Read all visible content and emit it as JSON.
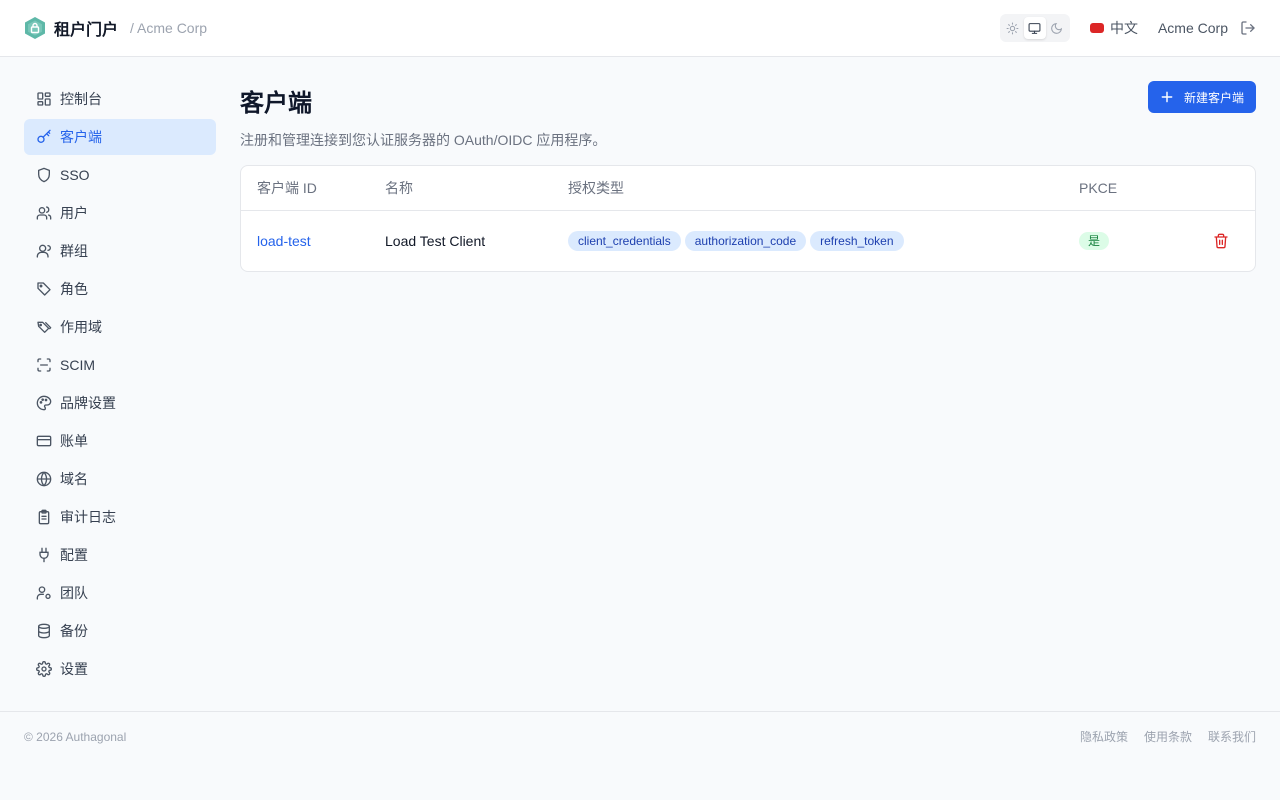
{
  "header": {
    "title": "租户门户",
    "tenant": "/ Acme Corp",
    "language": "中文",
    "account": "Acme Corp",
    "icons": [
      "shield-lock-logo",
      "sun-icon",
      "monitor-icon",
      "moon-icon",
      "flag-icon",
      "logout-icon"
    ]
  },
  "sidebar": {
    "items": [
      {
        "label": "控制台",
        "icon": "dashboard-icon"
      },
      {
        "label": "客户端",
        "icon": "key-icon",
        "active": true
      },
      {
        "label": "SSO",
        "icon": "shield-icon"
      },
      {
        "label": "用户",
        "icon": "users-icon"
      },
      {
        "label": "群组",
        "icon": "user-group-icon"
      },
      {
        "label": "角色",
        "icon": "tag-icon"
      },
      {
        "label": "作用域",
        "icon": "tags-icon"
      },
      {
        "label": "SCIM",
        "icon": "scan-icon"
      },
      {
        "label": "品牌设置",
        "icon": "palette-icon"
      },
      {
        "label": "账单",
        "icon": "credit-card-icon"
      },
      {
        "label": "域名",
        "icon": "globe-icon"
      },
      {
        "label": "审计日志",
        "icon": "clipboard-icon"
      },
      {
        "label": "配置",
        "icon": "plug-icon"
      },
      {
        "label": "团队",
        "icon": "team-icon"
      },
      {
        "label": "备份",
        "icon": "database-icon"
      },
      {
        "label": "设置",
        "icon": "gear-icon"
      }
    ]
  },
  "main": {
    "title": "客户端",
    "description": "注册和管理连接到您认证服务器的 OAuth/OIDC 应用程序。",
    "new_button": "新建客户端",
    "table": {
      "columns": [
        "客户端 ID",
        "名称",
        "授权类型",
        "PKCE"
      ],
      "rows": [
        {
          "client_id": "load-test",
          "name": "Load Test Client",
          "grant_types": [
            "client_credentials",
            "authorization_code",
            "refresh_token"
          ],
          "pkce": "是"
        }
      ]
    }
  },
  "footer": {
    "copyright": "© 2026 Authagonal",
    "links": [
      "隐私政策",
      "使用条款",
      "联系我们"
    ]
  },
  "colors": {
    "primary": "#2563eb",
    "active_bg": "#dbeafe",
    "danger": "#dc2626",
    "success_bg": "#dcfce7",
    "success_text": "#15803d"
  }
}
